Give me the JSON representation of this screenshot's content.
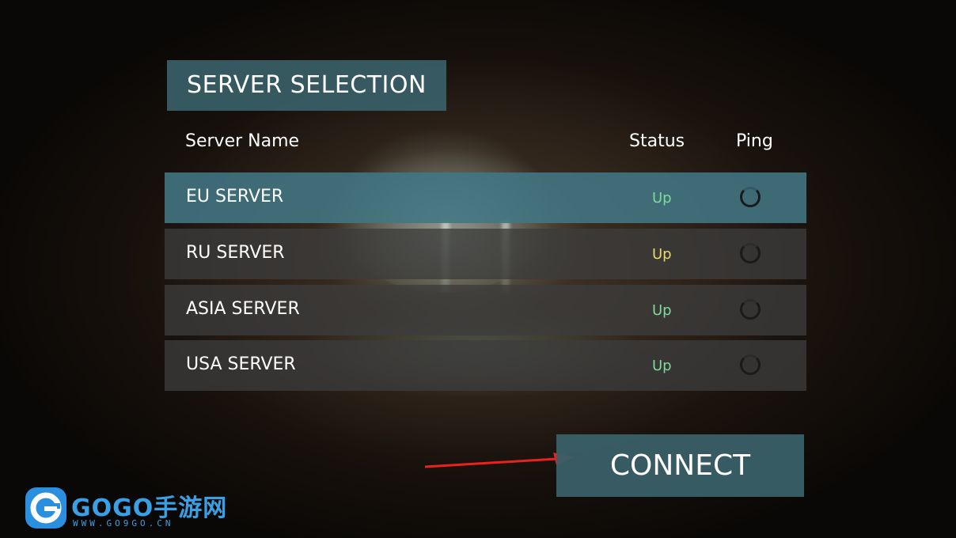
{
  "header": {
    "title": "SERVER SELECTION"
  },
  "columns": {
    "name": "Server Name",
    "status": "Status",
    "ping": "Ping"
  },
  "servers": [
    {
      "name": "EU SERVER",
      "status": "Up",
      "status_color": "#7ed99a",
      "selected": true
    },
    {
      "name": "RU SERVER",
      "status": "Up",
      "status_color": "#e8d86a",
      "selected": false
    },
    {
      "name": "ASIA SERVER",
      "status": "Up",
      "status_color": "#7ed99a",
      "selected": false
    },
    {
      "name": "USA SERVER",
      "status": "Up",
      "status_color": "#7ed99a",
      "selected": false
    }
  ],
  "actions": {
    "connect_label": "CONNECT"
  },
  "watermark": {
    "brand": "GOGO手游网",
    "url": "WWW.GO9GO.CN"
  },
  "colors": {
    "accent": "#3a6068",
    "selected_row": "#427684",
    "row": "#3c3c3c",
    "arrow": "#e8231e",
    "logo": "#3aa0e6"
  }
}
